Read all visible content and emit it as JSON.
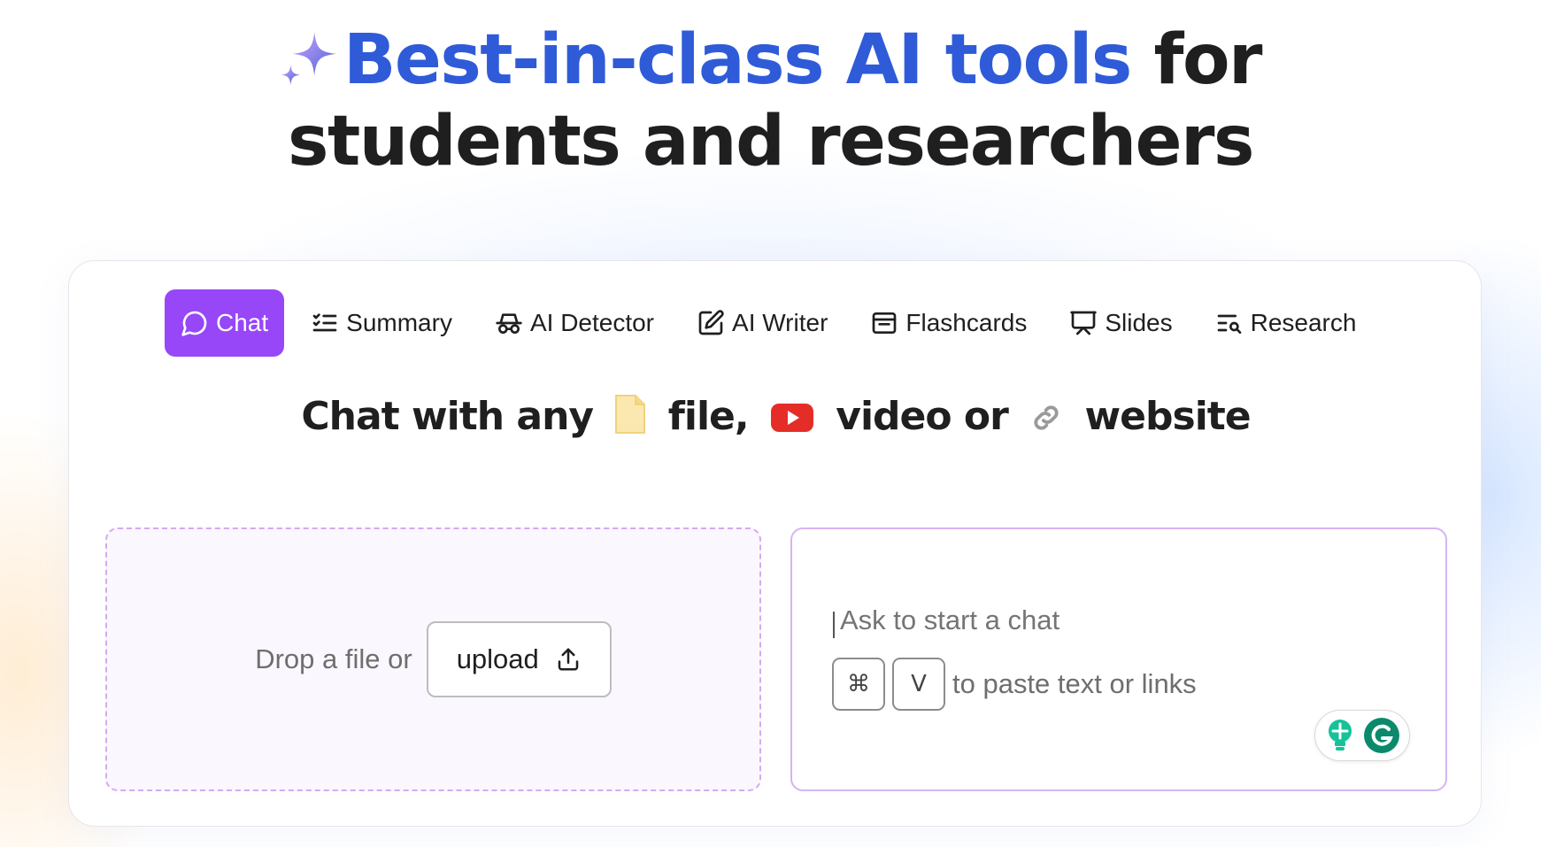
{
  "headline": {
    "accent_text": "Best-in-class AI tools",
    "rest_line1": " for",
    "line2": "students and researchers",
    "icon": "sparkle-icon",
    "accent_color": "#2f5bd8"
  },
  "tabs": [
    {
      "label": "Chat",
      "icon": "chat-bubble-icon",
      "active": true
    },
    {
      "label": "Summary",
      "icon": "checklist-icon",
      "active": false
    },
    {
      "label": "AI Detector",
      "icon": "incognito-icon",
      "active": false
    },
    {
      "label": "AI Writer",
      "icon": "edit-icon",
      "active": false
    },
    {
      "label": "Flashcards",
      "icon": "cards-icon",
      "active": false
    },
    {
      "label": "Slides",
      "icon": "presentation-icon",
      "active": false
    },
    {
      "label": "Research",
      "icon": "search-list-icon",
      "active": false
    }
  ],
  "active_tab_color": "#9747f7",
  "subheading": {
    "part1": "Chat with any",
    "part2": "file,",
    "part3": "video or",
    "part4": "website"
  },
  "dropzone": {
    "text": "Drop a file or",
    "upload_label": "upload"
  },
  "chat": {
    "placeholder": "Ask to start a chat",
    "key1": "⌘",
    "key2": "V",
    "paste_hint": "to paste text or links"
  }
}
